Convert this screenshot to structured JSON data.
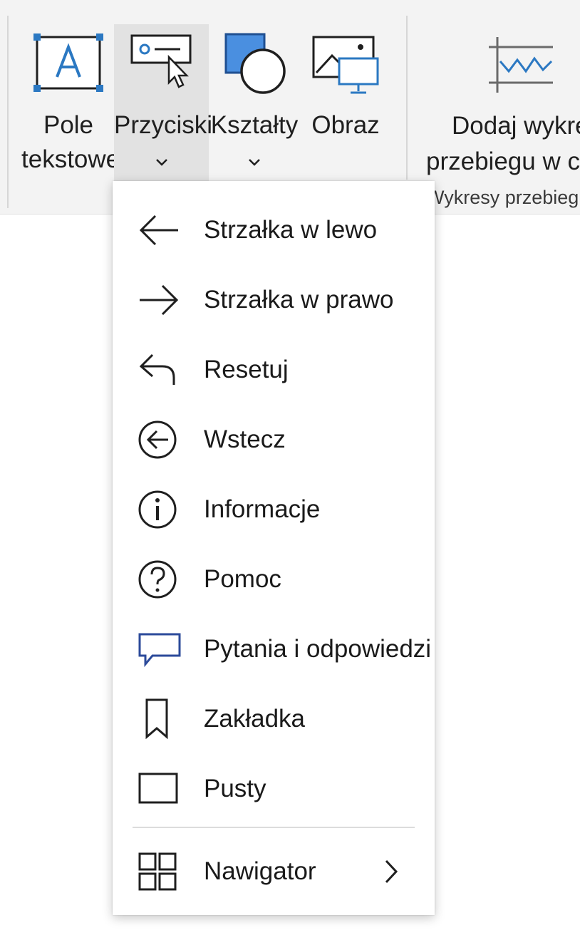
{
  "ribbon": {
    "text_box": {
      "line1": "Pole",
      "line2": "tekstowe",
      "icon": "text-box-icon"
    },
    "buttons": {
      "label": "Przyciski",
      "icon": "button-control-icon"
    },
    "shapes": {
      "label": "Kształty",
      "icon": "shapes-icon"
    },
    "image": {
      "label": "Obraz",
      "icon": "image-icon"
    },
    "sparkline": {
      "line1": "Dodaj wykre",
      "line2": "przebiegu w cz",
      "icon": "sparkline-chart-icon"
    },
    "group_label": "Wykresy przebiegu",
    "accent_color": "#2b78c2"
  },
  "menu": {
    "items": [
      {
        "label": "Strzałka w lewo",
        "icon": "arrow-left-icon"
      },
      {
        "label": "Strzałka w prawo",
        "icon": "arrow-right-icon"
      },
      {
        "label": "Resetuj",
        "icon": "reset-icon"
      },
      {
        "label": "Wstecz",
        "icon": "back-circle-icon"
      },
      {
        "label": "Informacje",
        "icon": "info-icon"
      },
      {
        "label": "Pomoc",
        "icon": "help-icon"
      },
      {
        "label": "Pytania i odpowiedzi",
        "icon": "speech-bubble-icon"
      },
      {
        "label": "Zakładka",
        "icon": "bookmark-icon"
      },
      {
        "label": "Pusty",
        "icon": "blank-rectangle-icon"
      }
    ],
    "navigator": {
      "label": "Nawigator",
      "icon": "navigator-grid-icon"
    },
    "bubble_color": "#2b4a9a"
  }
}
